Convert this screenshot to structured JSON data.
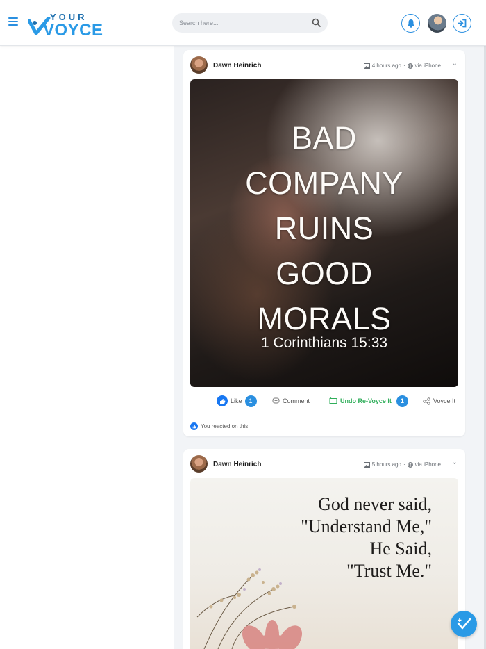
{
  "app": {
    "logo_top": "YOUR",
    "logo_main": "VOYCE"
  },
  "search": {
    "placeholder": "Search here..."
  },
  "icons": {
    "menu": "hamburger-icon",
    "search": "search-icon",
    "bell": "bell-icon",
    "login": "sign-in-icon",
    "compose": "voyce-check-icon"
  },
  "colors": {
    "accent": "#2a8fe0",
    "revoyce": "#2fae5a",
    "like": "#1877f2"
  },
  "posts": [
    {
      "author": "Dawn Heinrich",
      "time": "4 hours ago",
      "via": "via iPhone",
      "image_text": [
        "BAD",
        "COMPANY",
        "RUINS",
        "GOOD",
        "MORALS"
      ],
      "image_ref": "1 Corinthians 15:33",
      "actions": {
        "like": "Like",
        "like_count": "1",
        "comment": "Comment",
        "revoyce": "Undo Re-Voyce It",
        "revoyce_count": "1",
        "voyce": "Voyce It"
      },
      "reacted": "You reacted on this."
    },
    {
      "author": "Dawn Heinrich",
      "time": "5 hours ago",
      "via": "via iPhone",
      "image_text": [
        "God never said,",
        "\"Understand Me,\"",
        "He Said,",
        "\"Trust Me.\""
      ]
    }
  ]
}
